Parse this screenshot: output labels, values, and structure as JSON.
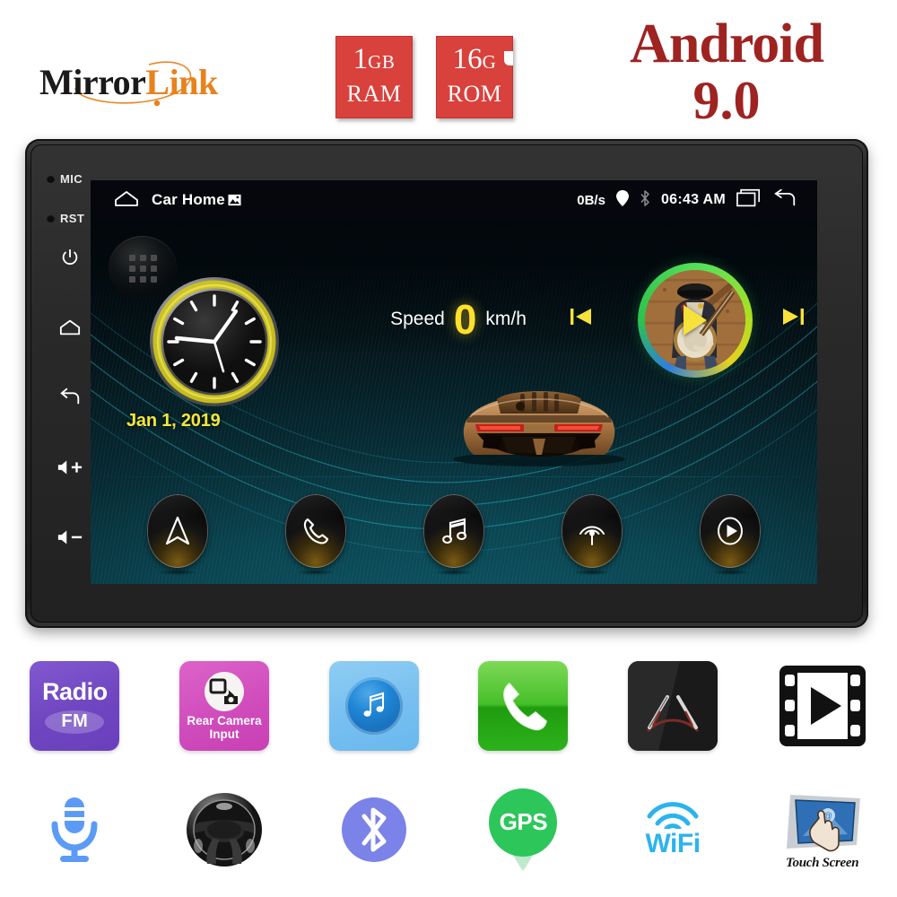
{
  "banner": {
    "mirrorlink": {
      "part1": "Mirror",
      "part2": "Link",
      "icon": "mirrorlink-logo"
    },
    "memory": [
      {
        "name": "ram-badge",
        "line1_value": "1",
        "line1_unit": "GB",
        "line2": "RAM"
      },
      {
        "name": "rom-badge",
        "line1_value": "16",
        "line1_unit": "G",
        "line2": "ROM"
      }
    ],
    "android": {
      "name": "Android",
      "version": "9.0",
      "color": "#9E2321"
    }
  },
  "head_unit": {
    "bezel_buttons": [
      {
        "label": "MIC",
        "icon": "mic-indicator-dot"
      },
      {
        "label": "RST",
        "icon": "reset-indicator-dot"
      },
      {
        "label": "",
        "icon": "power-icon"
      },
      {
        "label": "",
        "icon": "home-icon"
      },
      {
        "label": "",
        "icon": "back-icon"
      },
      {
        "label": "",
        "icon": "volume-up-icon"
      },
      {
        "label": "",
        "icon": "volume-down-icon"
      }
    ],
    "bezel_labels": {
      "mic": "MIC",
      "rst": "RST",
      "vol_up": "+",
      "vol_down": "–"
    }
  },
  "screen": {
    "status_bar": {
      "home_icon": "home-icon",
      "title": "Car Home",
      "title_icon": "image-icon",
      "data_rate": "0B/s",
      "location_icon": "location-pin-icon",
      "bluetooth_icon": "bluetooth-icon",
      "clock": "06:43 AM",
      "recents_icon": "recents-icon",
      "back_icon": "back-arrow-icon"
    },
    "app_drawer": {
      "icon": "app-grid-icon"
    },
    "clock_widget": {
      "icon": "analog-clock-icon",
      "ring_color": "#D8D020"
    },
    "date": "Jan 1, 2019",
    "speed": {
      "label": "Speed",
      "value": "0",
      "unit": "km/h",
      "value_color": "#FFE02A"
    },
    "media": {
      "album_icon": "album-art-banjo-player",
      "play_icon": "play-icon",
      "prev_icon": "previous-track-icon",
      "next_icon": "next-track-icon",
      "ring_color": "#4FD255"
    },
    "car_icon": "sports-car-rear-image",
    "dock": [
      {
        "name": "navigation",
        "icon": "navigation-arrow-icon"
      },
      {
        "name": "phone",
        "icon": "phone-icon"
      },
      {
        "name": "music",
        "icon": "music-note-icon"
      },
      {
        "name": "radio",
        "icon": "radio-antenna-icon"
      },
      {
        "name": "video",
        "icon": "video-play-icon"
      }
    ]
  },
  "features_row1": [
    {
      "name": "radio-fm",
      "title": "Radio",
      "subtitle": "FM",
      "icon": "radio-fm-badge",
      "color": "#6F46C0"
    },
    {
      "name": "rear-camera-input",
      "title": "Rear Camera",
      "subtitle": "Input",
      "icon": "rear-camera-icon",
      "color": "#CF4BBB"
    },
    {
      "name": "music-player",
      "title": "",
      "subtitle": "",
      "icon": "music-note-badge",
      "color": "#76BFF0"
    },
    {
      "name": "hands-free-call",
      "title": "",
      "subtitle": "",
      "icon": "phone-handset-badge",
      "color": "#46BF2A"
    },
    {
      "name": "parking-guidelines",
      "title": "",
      "subtitle": "",
      "icon": "parking-guideline-camera-badge",
      "color": "#1A1A1A"
    },
    {
      "name": "video-playback",
      "title": "",
      "subtitle": "",
      "icon": "film-play-badge",
      "color": "#111111"
    }
  ],
  "features_row2": [
    {
      "name": "voice-control",
      "title": "",
      "icon": "microphone-icon",
      "color": "#5B9BF5"
    },
    {
      "name": "steering-wheel-control",
      "title": "",
      "icon": "steering-wheel-icon",
      "color": "#4A4A4A"
    },
    {
      "name": "bluetooth",
      "title": "",
      "icon": "bluetooth-badge-icon",
      "color": "#7B82E8"
    },
    {
      "name": "gps",
      "title": "GPS",
      "icon": "gps-pin-icon",
      "color": "#2DC65A"
    },
    {
      "name": "wifi",
      "title": "WiFi",
      "icon": "wifi-icon",
      "color": "#2BB3EE"
    },
    {
      "name": "touch-screen",
      "title": "Touch Screen",
      "icon": "touch-screen-icon",
      "color": "#2F6FB5"
    }
  ]
}
